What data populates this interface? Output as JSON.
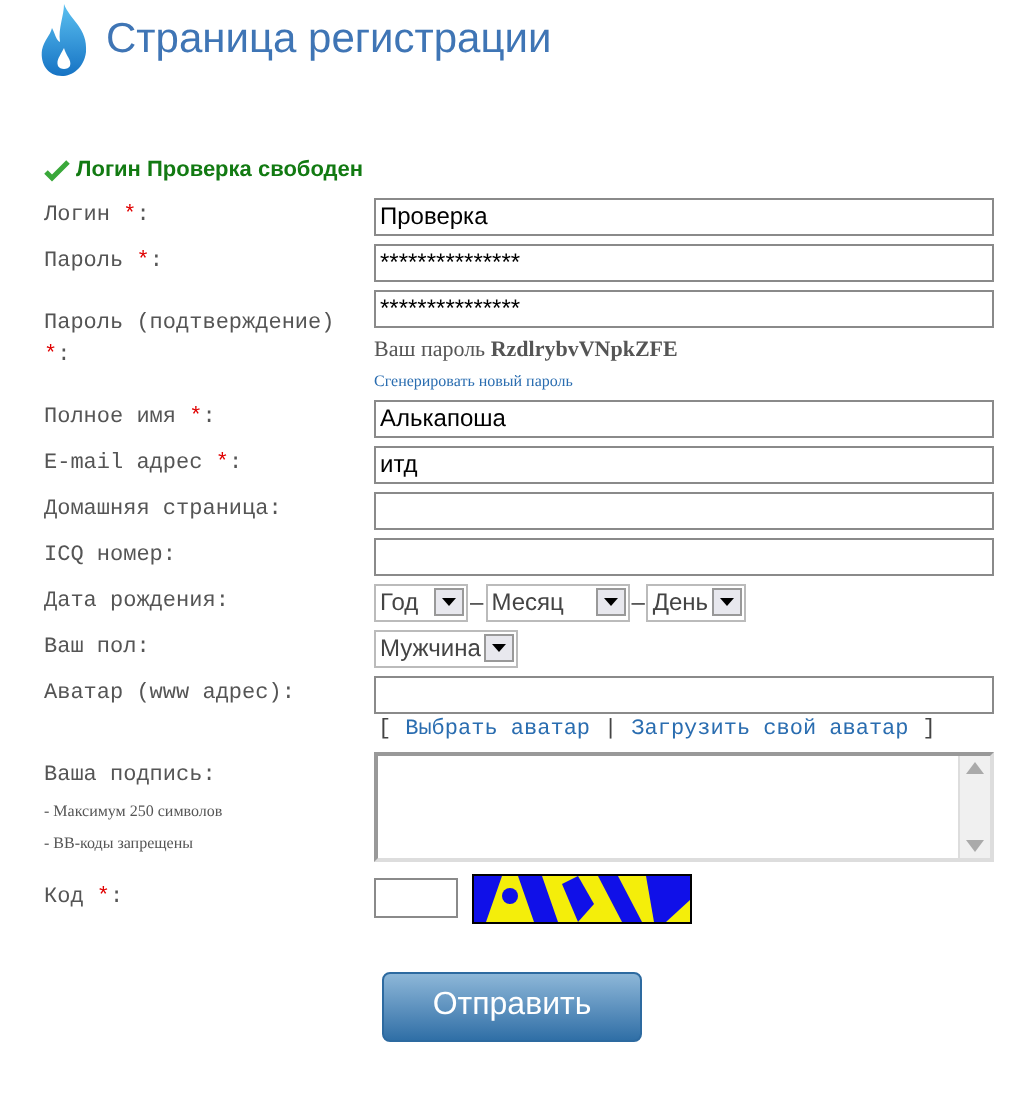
{
  "title": "Страница регистрации",
  "status": {
    "text": "Логин Проверка свободен"
  },
  "fields": [
    {
      "kind": "text",
      "label": "Логин",
      "required_mark": "*",
      "suffix": ":",
      "value": "Проверка"
    },
    {
      "kind": "text",
      "label": "Пароль",
      "required_mark": "*",
      "suffix": ":",
      "value": "***************"
    },
    {
      "kind": "password-confirm",
      "label": "Пароль (подтверждение)",
      "required_mark": "*",
      "suffix": ":",
      "value": "***************",
      "hint": "Ваш пароль **RzdlrybvVNpkZFE**",
      "link": "Сгенерировать новый пароль"
    },
    {
      "kind": "text",
      "label": "Полное имя",
      "required_mark": "*",
      "suffix": ":",
      "value": "Алькапоша"
    },
    {
      "kind": "text",
      "label": "E-mail адрес",
      "required_mark": "*",
      "suffix": ":",
      "value": "итд"
    },
    {
      "kind": "text",
      "label": "Домашняя страница:"
    },
    {
      "kind": "text",
      "label": "ICQ номер:"
    },
    {
      "kind": "date",
      "label": "Дата рождения:",
      "selects": [
        "Год",
        "Месяц",
        "День"
      ],
      "separator": "–"
    },
    {
      "kind": "select",
      "label": "Ваш пол:",
      "value": "Мужчина"
    },
    {
      "kind": "avatar",
      "label": "Аватар (www адрес):",
      "open_bracket": "[",
      "links": [
        "Выбрать аватар",
        "Загрузить свой аватар"
      ],
      "divider": "|",
      "close_bracket": "]"
    },
    {
      "kind": "textarea",
      "label": "Ваша подпись:",
      "notes": [
        "- Максимум 250 символов",
        "- BB-коды запрещены"
      ]
    },
    {
      "kind": "captcha",
      "label": "Код",
      "required_mark": "*",
      "suffix": ":"
    }
  ],
  "submit": "Отправить"
}
